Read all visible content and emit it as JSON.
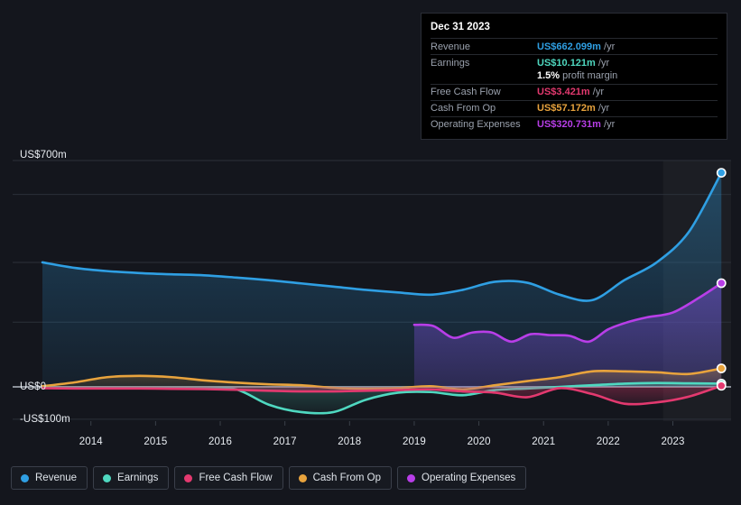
{
  "tooltip": {
    "title": "Dec 31 2023",
    "rows": [
      {
        "label": "Revenue",
        "value": "US$662.099m",
        "unit": "/yr",
        "color": "#2f9fe3"
      },
      {
        "label": "Earnings",
        "value": "US$10.121m",
        "unit": "/yr",
        "color": "#4fd8c0"
      },
      {
        "label": "Free Cash Flow",
        "value": "US$3.421m",
        "unit": "/yr",
        "color": "#e3396f"
      },
      {
        "label": "Cash From Op",
        "value": "US$57.172m",
        "unit": "/yr",
        "color": "#e8a33d"
      },
      {
        "label": "Operating Expenses",
        "value": "US$320.731m",
        "unit": "/yr",
        "color": "#b83ee8"
      }
    ],
    "profit_margin_value": "1.5%",
    "profit_margin_text": "profit margin"
  },
  "legend": [
    {
      "label": "Revenue",
      "color": "#2f9fe3"
    },
    {
      "label": "Earnings",
      "color": "#4fd8c0"
    },
    {
      "label": "Free Cash Flow",
      "color": "#e3396f"
    },
    {
      "label": "Cash From Op",
      "color": "#e8a33d"
    },
    {
      "label": "Operating Expenses",
      "color": "#b83ee8"
    }
  ],
  "chart_data": {
    "type": "area",
    "title": "",
    "xlabel": "",
    "ylabel": "",
    "grid": true,
    "legend_position": "bottom",
    "xlim": [
      2013.25,
      2023.9
    ],
    "ylim": [
      -100,
      700
    ],
    "x_ticks": [
      2014,
      2015,
      2016,
      2017,
      2018,
      2019,
      2020,
      2021,
      2022,
      2023
    ],
    "x_tick_labels": [
      "2014",
      "2015",
      "2016",
      "2017",
      "2018",
      "2019",
      "2020",
      "2021",
      "2022",
      "2023"
    ],
    "y_ticks": [
      -100,
      0,
      700
    ],
    "y_tick_labels": [
      "-US$100m",
      "US$0",
      "US$700m"
    ],
    "y_gridlines": [
      700,
      595,
      385,
      200,
      0,
      -100
    ],
    "units": "US$m",
    "series": [
      {
        "name": "Revenue",
        "color": "#2f9fe3",
        "x": [
          2013.25,
          2013.75,
          2014.25,
          2014.75,
          2015.25,
          2015.75,
          2016.25,
          2016.75,
          2017.25,
          2017.75,
          2018.25,
          2018.75,
          2019.25,
          2019.75,
          2020.25,
          2020.75,
          2021.25,
          2021.75,
          2022.25,
          2022.75,
          2023.25,
          2023.75
        ],
        "values": [
          385,
          368,
          358,
          352,
          348,
          345,
          338,
          330,
          320,
          310,
          300,
          292,
          285,
          300,
          325,
          322,
          285,
          268,
          330,
          385,
          480,
          662.099
        ]
      },
      {
        "name": "Operating Expenses",
        "color": "#b83ee8",
        "x": [
          2019.0,
          2019.3,
          2019.6,
          2019.9,
          2020.2,
          2020.5,
          2020.8,
          2021.1,
          2021.4,
          2021.7,
          2022.0,
          2022.3,
          2022.6,
          2023.0,
          2023.4,
          2023.75
        ],
        "values": [
          192,
          188,
          152,
          168,
          168,
          140,
          163,
          160,
          158,
          140,
          178,
          200,
          215,
          230,
          275,
          320.731
        ]
      },
      {
        "name": "Cash From Op",
        "color": "#e8a33d",
        "x": [
          2013.25,
          2013.75,
          2014.25,
          2014.75,
          2015.25,
          2015.75,
          2016.25,
          2016.75,
          2017.25,
          2017.75,
          2018.25,
          2018.75,
          2019.25,
          2019.75,
          2020.25,
          2020.75,
          2021.25,
          2021.75,
          2022.25,
          2022.75,
          2023.25,
          2023.75
        ],
        "values": [
          2,
          14,
          30,
          34,
          30,
          20,
          13,
          8,
          5,
          -3,
          -6,
          -4,
          2,
          -8,
          5,
          18,
          30,
          48,
          48,
          45,
          40,
          57.172
        ]
      },
      {
        "name": "Earnings",
        "color": "#4fd8c0",
        "x": [
          2013.25,
          2013.75,
          2014.25,
          2014.75,
          2015.25,
          2015.75,
          2016.25,
          2016.75,
          2017.25,
          2017.75,
          2018.25,
          2018.75,
          2019.25,
          2019.75,
          2020.25,
          2020.75,
          2021.25,
          2021.75,
          2022.25,
          2022.75,
          2023.25,
          2023.75
        ],
        "values": [
          -3,
          -4,
          -4,
          -4,
          -5,
          -6,
          -8,
          -55,
          -78,
          -78,
          -40,
          -18,
          -16,
          -26,
          -10,
          -5,
          0,
          5,
          10,
          12,
          11,
          10.121
        ]
      },
      {
        "name": "Free Cash Flow",
        "color": "#e3396f",
        "x": [
          2013.25,
          2013.75,
          2014.25,
          2014.75,
          2015.25,
          2015.75,
          2016.25,
          2016.75,
          2017.25,
          2017.75,
          2018.25,
          2018.75,
          2019.25,
          2019.75,
          2020.25,
          2020.75,
          2021.25,
          2021.75,
          2022.25,
          2022.75,
          2023.25,
          2023.75
        ],
        "values": [
          -4,
          -5,
          -5,
          -5,
          -6,
          -7,
          -9,
          -12,
          -14,
          -14,
          -12,
          -10,
          -8,
          -14,
          -18,
          -32,
          -4,
          -22,
          -52,
          -48,
          -30,
          3.421
        ]
      }
    ],
    "highlight_band": {
      "from": 2022.85,
      "to": 2023.9
    },
    "end_markers": [
      {
        "series": "Revenue",
        "x": 2023.75,
        "y": 662.099
      },
      {
        "series": "Operating Expenses",
        "x": 2023.75,
        "y": 320.731
      },
      {
        "series": "Cash From Op",
        "x": 2023.75,
        "y": 57.172
      },
      {
        "series": "Earnings",
        "x": 2023.75,
        "y": 10.121
      },
      {
        "series": "Free Cash Flow",
        "x": 2023.75,
        "y": 3.421
      }
    ]
  }
}
